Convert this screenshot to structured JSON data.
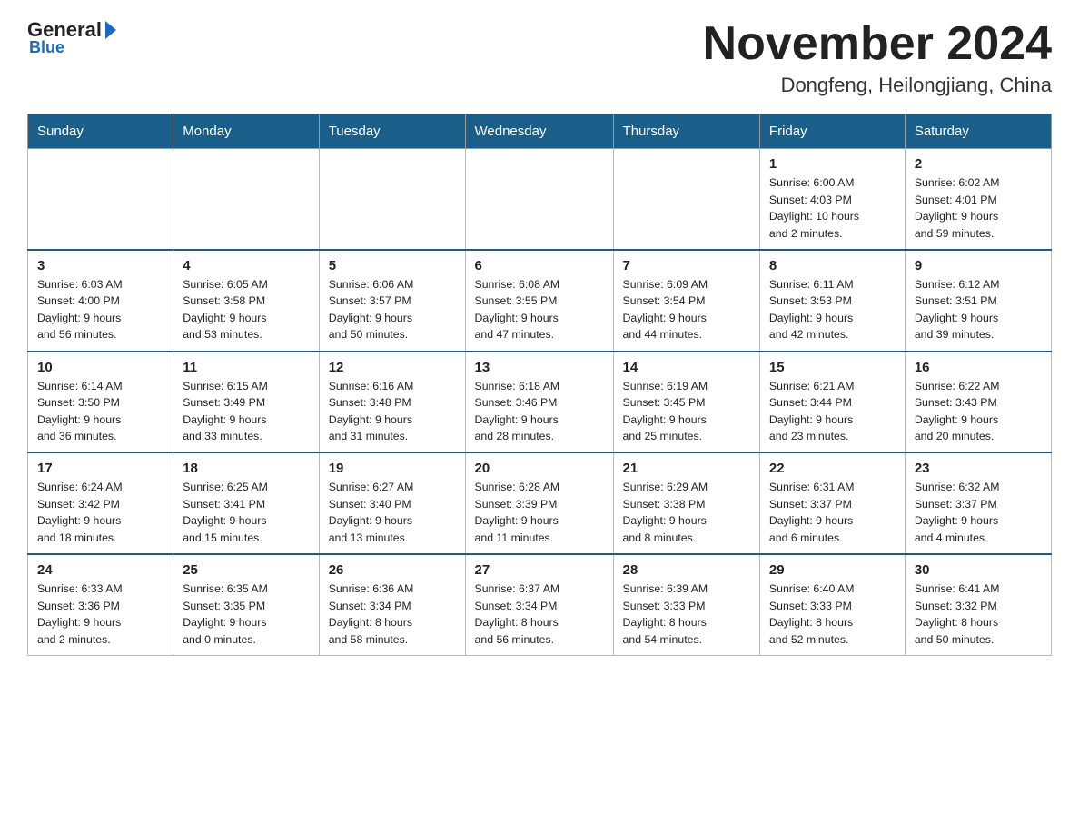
{
  "header": {
    "logo_general": "General",
    "logo_blue": "Blue",
    "month_title": "November 2024",
    "location": "Dongfeng, Heilongjiang, China"
  },
  "weekdays": [
    "Sunday",
    "Monday",
    "Tuesday",
    "Wednesday",
    "Thursday",
    "Friday",
    "Saturday"
  ],
  "weeks": [
    [
      {
        "day": "",
        "info": ""
      },
      {
        "day": "",
        "info": ""
      },
      {
        "day": "",
        "info": ""
      },
      {
        "day": "",
        "info": ""
      },
      {
        "day": "",
        "info": ""
      },
      {
        "day": "1",
        "info": "Sunrise: 6:00 AM\nSunset: 4:03 PM\nDaylight: 10 hours\nand 2 minutes."
      },
      {
        "day": "2",
        "info": "Sunrise: 6:02 AM\nSunset: 4:01 PM\nDaylight: 9 hours\nand 59 minutes."
      }
    ],
    [
      {
        "day": "3",
        "info": "Sunrise: 6:03 AM\nSunset: 4:00 PM\nDaylight: 9 hours\nand 56 minutes."
      },
      {
        "day": "4",
        "info": "Sunrise: 6:05 AM\nSunset: 3:58 PM\nDaylight: 9 hours\nand 53 minutes."
      },
      {
        "day": "5",
        "info": "Sunrise: 6:06 AM\nSunset: 3:57 PM\nDaylight: 9 hours\nand 50 minutes."
      },
      {
        "day": "6",
        "info": "Sunrise: 6:08 AM\nSunset: 3:55 PM\nDaylight: 9 hours\nand 47 minutes."
      },
      {
        "day": "7",
        "info": "Sunrise: 6:09 AM\nSunset: 3:54 PM\nDaylight: 9 hours\nand 44 minutes."
      },
      {
        "day": "8",
        "info": "Sunrise: 6:11 AM\nSunset: 3:53 PM\nDaylight: 9 hours\nand 42 minutes."
      },
      {
        "day": "9",
        "info": "Sunrise: 6:12 AM\nSunset: 3:51 PM\nDaylight: 9 hours\nand 39 minutes."
      }
    ],
    [
      {
        "day": "10",
        "info": "Sunrise: 6:14 AM\nSunset: 3:50 PM\nDaylight: 9 hours\nand 36 minutes."
      },
      {
        "day": "11",
        "info": "Sunrise: 6:15 AM\nSunset: 3:49 PM\nDaylight: 9 hours\nand 33 minutes."
      },
      {
        "day": "12",
        "info": "Sunrise: 6:16 AM\nSunset: 3:48 PM\nDaylight: 9 hours\nand 31 minutes."
      },
      {
        "day": "13",
        "info": "Sunrise: 6:18 AM\nSunset: 3:46 PM\nDaylight: 9 hours\nand 28 minutes."
      },
      {
        "day": "14",
        "info": "Sunrise: 6:19 AM\nSunset: 3:45 PM\nDaylight: 9 hours\nand 25 minutes."
      },
      {
        "day": "15",
        "info": "Sunrise: 6:21 AM\nSunset: 3:44 PM\nDaylight: 9 hours\nand 23 minutes."
      },
      {
        "day": "16",
        "info": "Sunrise: 6:22 AM\nSunset: 3:43 PM\nDaylight: 9 hours\nand 20 minutes."
      }
    ],
    [
      {
        "day": "17",
        "info": "Sunrise: 6:24 AM\nSunset: 3:42 PM\nDaylight: 9 hours\nand 18 minutes."
      },
      {
        "day": "18",
        "info": "Sunrise: 6:25 AM\nSunset: 3:41 PM\nDaylight: 9 hours\nand 15 minutes."
      },
      {
        "day": "19",
        "info": "Sunrise: 6:27 AM\nSunset: 3:40 PM\nDaylight: 9 hours\nand 13 minutes."
      },
      {
        "day": "20",
        "info": "Sunrise: 6:28 AM\nSunset: 3:39 PM\nDaylight: 9 hours\nand 11 minutes."
      },
      {
        "day": "21",
        "info": "Sunrise: 6:29 AM\nSunset: 3:38 PM\nDaylight: 9 hours\nand 8 minutes."
      },
      {
        "day": "22",
        "info": "Sunrise: 6:31 AM\nSunset: 3:37 PM\nDaylight: 9 hours\nand 6 minutes."
      },
      {
        "day": "23",
        "info": "Sunrise: 6:32 AM\nSunset: 3:37 PM\nDaylight: 9 hours\nand 4 minutes."
      }
    ],
    [
      {
        "day": "24",
        "info": "Sunrise: 6:33 AM\nSunset: 3:36 PM\nDaylight: 9 hours\nand 2 minutes."
      },
      {
        "day": "25",
        "info": "Sunrise: 6:35 AM\nSunset: 3:35 PM\nDaylight: 9 hours\nand 0 minutes."
      },
      {
        "day": "26",
        "info": "Sunrise: 6:36 AM\nSunset: 3:34 PM\nDaylight: 8 hours\nand 58 minutes."
      },
      {
        "day": "27",
        "info": "Sunrise: 6:37 AM\nSunset: 3:34 PM\nDaylight: 8 hours\nand 56 minutes."
      },
      {
        "day": "28",
        "info": "Sunrise: 6:39 AM\nSunset: 3:33 PM\nDaylight: 8 hours\nand 54 minutes."
      },
      {
        "day": "29",
        "info": "Sunrise: 6:40 AM\nSunset: 3:33 PM\nDaylight: 8 hours\nand 52 minutes."
      },
      {
        "day": "30",
        "info": "Sunrise: 6:41 AM\nSunset: 3:32 PM\nDaylight: 8 hours\nand 50 minutes."
      }
    ]
  ]
}
